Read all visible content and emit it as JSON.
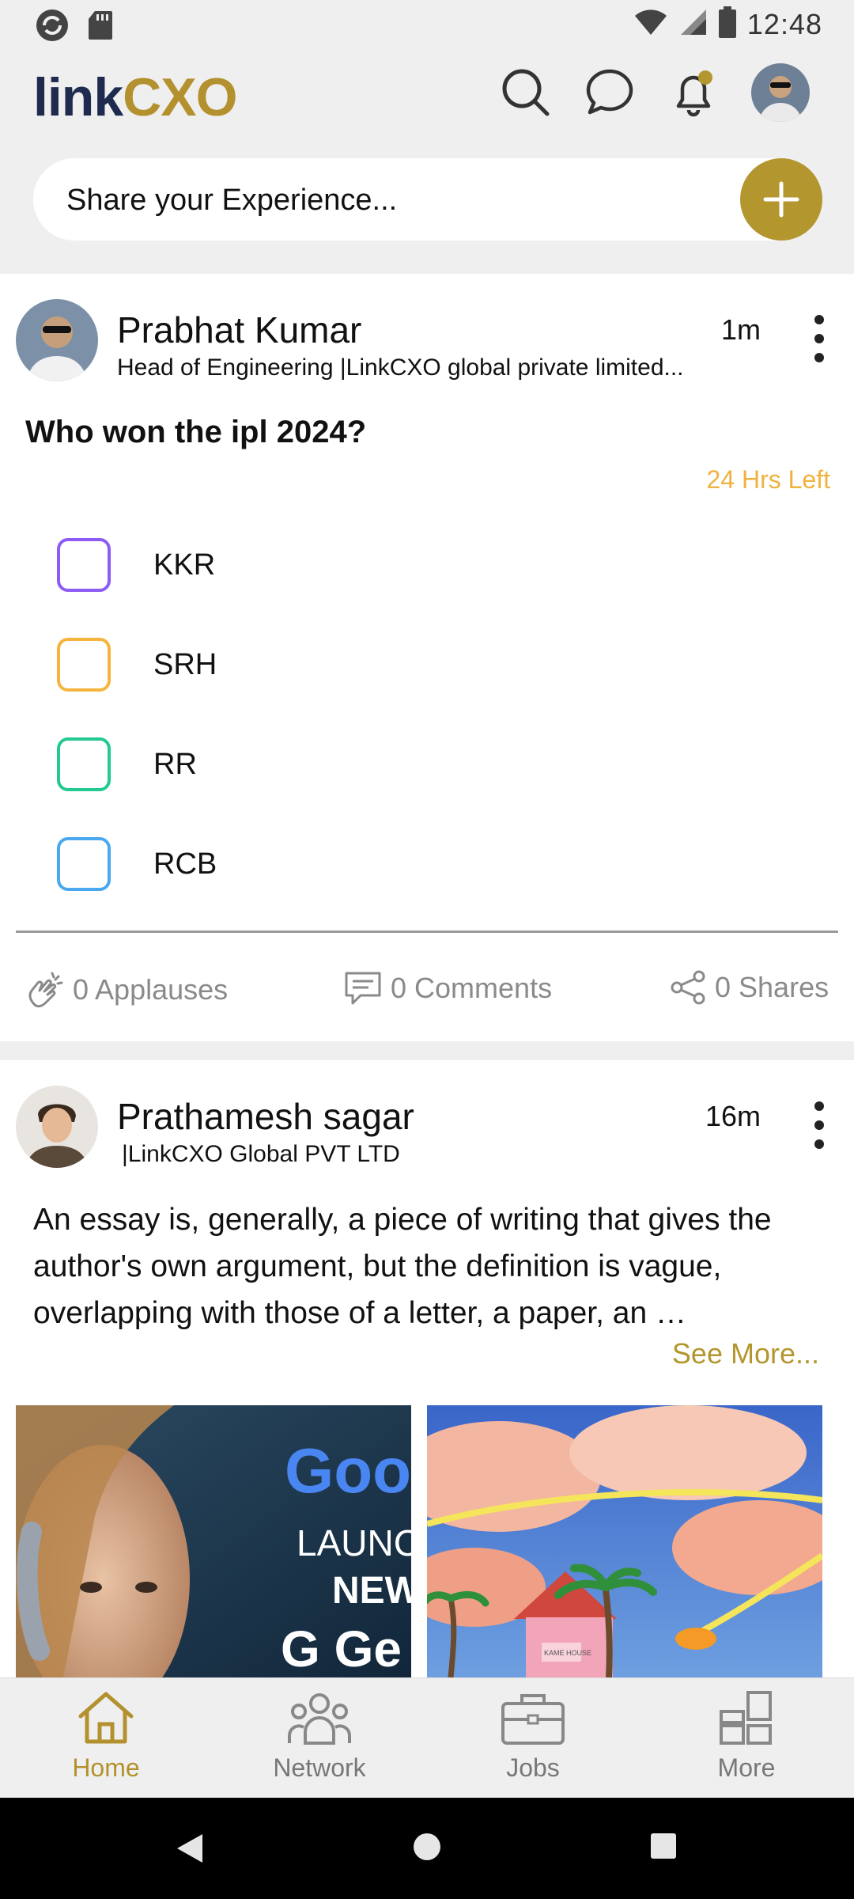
{
  "status_bar": {
    "time": "12:48"
  },
  "header": {
    "logo_link": "link",
    "logo_cxo": "CXO",
    "icons": [
      "search-icon",
      "chat-icon",
      "notification-bell-icon",
      "profile-avatar"
    ]
  },
  "share": {
    "placeholder": "Share your Experience..."
  },
  "posts": [
    {
      "author": "Prabhat Kumar",
      "subtitle": "Head of Engineering |LinkCXO global private limited...",
      "time": "1m",
      "question": "Who won the ipl 2024?",
      "time_left": "24 Hrs Left",
      "options": [
        {
          "label": "KKR",
          "color": "#8b5cf6"
        },
        {
          "label": "SRH",
          "color": "#f5b43e"
        },
        {
          "label": "RR",
          "color": "#22c993"
        },
        {
          "label": "RCB",
          "color": "#4aa8f0"
        }
      ],
      "applauses": "0 Applauses",
      "comments": "0 Comments",
      "shares": "0 Shares"
    },
    {
      "author": "Prathamesh sagar",
      "subtitle": "|LinkCXO Global PVT LTD",
      "time": "16m",
      "body": "An essay is, generally, a piece of writing that gives the author's own argument, but the definition is vague, overlapping with those of a letter, a paper, an …",
      "see_more": "See More...",
      "image1_text_1": "Goo",
      "image1_text_2": "LAUNC",
      "image1_text_3": "NEW",
      "image1_text_4": "G Ge",
      "image2_sign": "KAME HOUSE"
    }
  ],
  "bottom_nav": [
    {
      "label": "Home",
      "active": true
    },
    {
      "label": "Network",
      "active": false
    },
    {
      "label": "Jobs",
      "active": false
    },
    {
      "label": "More",
      "active": false
    }
  ],
  "colors": {
    "accent": "#b4962e",
    "brand_dark": "#1f2a4f",
    "time_left": "#f0b23e"
  }
}
